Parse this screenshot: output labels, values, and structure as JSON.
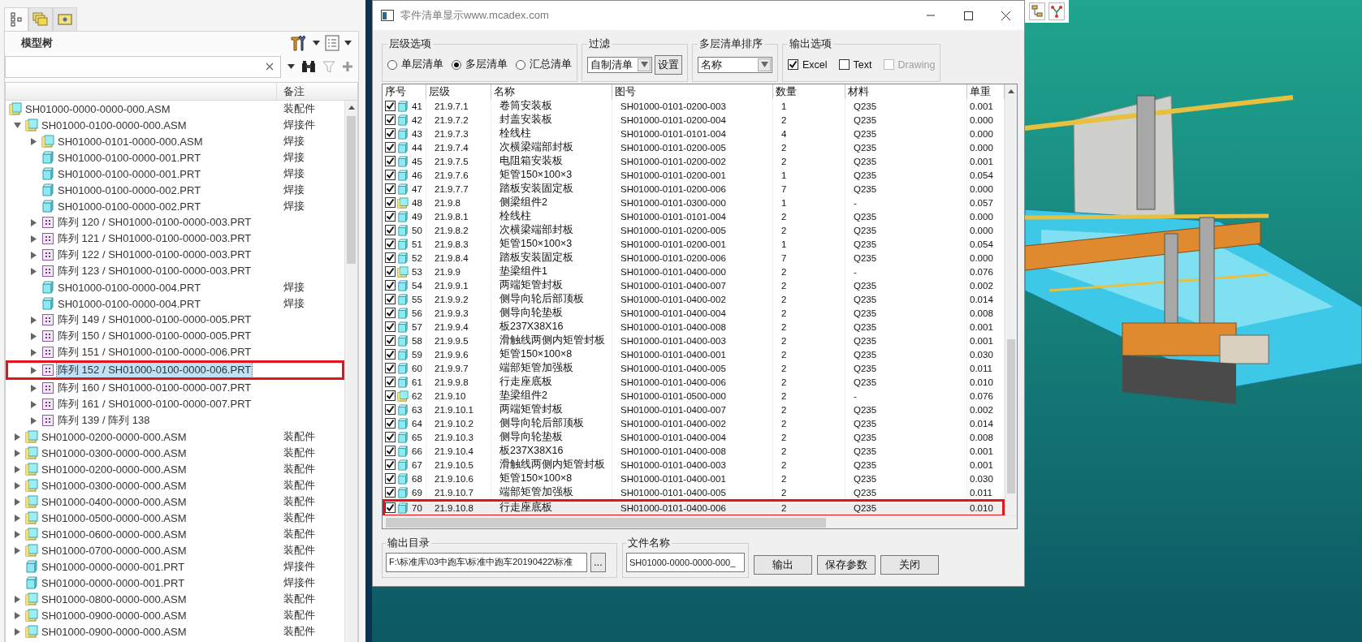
{
  "model_tree_panel": {
    "tabs": [
      {
        "kind": "tree",
        "selected": true
      },
      {
        "kind": "layers",
        "selected": false
      },
      {
        "kind": "folder",
        "selected": false
      }
    ],
    "title": "模型树",
    "column_header": "备注",
    "items": [
      {
        "kind": "asm",
        "label": "SH01000-0000-0000-000.ASM",
        "note": "装配件",
        "selected": false,
        "marked": false,
        "children": [
          {
            "kind": "asm",
            "label": "SH01000-0100-0000-000.ASM",
            "note": "焊接件",
            "expanded": true,
            "selected": false,
            "marked": false,
            "children": [
              {
                "kind": "asm",
                "label": "SH01000-0101-0000-000.ASM",
                "note": "焊接",
                "expanded": false,
                "selected": false,
                "marked": false
              },
              {
                "kind": "prt",
                "label": "SH01000-0100-0000-001.PRT",
                "note": "焊接",
                "selected": false,
                "marked": false
              },
              {
                "kind": "prt",
                "label": "SH01000-0100-0000-001.PRT",
                "note": "焊接",
                "selected": false,
                "marked": false
              },
              {
                "kind": "prt",
                "label": "SH01000-0100-0000-002.PRT",
                "note": "焊接",
                "selected": false,
                "marked": false
              },
              {
                "kind": "prt",
                "label": "SH01000-0100-0000-002.PRT",
                "note": "焊接",
                "selected": false,
                "marked": false
              },
              {
                "kind": "pattern",
                "label": "阵列 120 / SH01000-0100-0000-003.PRT",
                "expanded": false,
                "selected": false,
                "marked": false
              },
              {
                "kind": "pattern",
                "label": "阵列 121 / SH01000-0100-0000-003.PRT",
                "expanded": false,
                "selected": false,
                "marked": false
              },
              {
                "kind": "pattern",
                "label": "阵列 122 / SH01000-0100-0000-003.PRT",
                "expanded": false,
                "selected": false,
                "marked": false
              },
              {
                "kind": "pattern",
                "label": "阵列 123 / SH01000-0100-0000-003.PRT",
                "expanded": false,
                "selected": false,
                "marked": false
              },
              {
                "kind": "prt",
                "label": "SH01000-0100-0000-004.PRT",
                "note": "焊接",
                "selected": false,
                "marked": false
              },
              {
                "kind": "prt",
                "label": "SH01000-0100-0000-004.PRT",
                "note": "焊接",
                "selected": false,
                "marked": false
              },
              {
                "kind": "pattern",
                "label": "阵列 149 / SH01000-0100-0000-005.PRT",
                "expanded": false,
                "selected": false,
                "marked": false
              },
              {
                "kind": "pattern",
                "label": "阵列 150 / SH01000-0100-0000-005.PRT",
                "expanded": false,
                "selected": false,
                "marked": false
              },
              {
                "kind": "pattern",
                "label": "阵列 151 / SH01000-0100-0000-006.PRT",
                "expanded": false,
                "selected": false,
                "marked": false
              },
              {
                "kind": "pattern",
                "label": "阵列 152 / SH01000-0100-0000-006.PRT",
                "expanded": false,
                "selected": true,
                "marked": true
              },
              {
                "kind": "pattern",
                "label": "阵列 160 / SH01000-0100-0000-007.PRT",
                "expanded": false,
                "selected": false,
                "marked": false
              },
              {
                "kind": "pattern",
                "label": "阵列 161 / SH01000-0100-0000-007.PRT",
                "expanded": false,
                "selected": false,
                "marked": false
              },
              {
                "kind": "pattern",
                "label": "阵列 139 / 阵列 138",
                "expanded": false,
                "selected": false,
                "marked": false
              }
            ]
          },
          {
            "kind": "asm",
            "label": "SH01000-0200-0000-000.ASM",
            "note": "装配件",
            "expanded": false,
            "selected": false,
            "marked": false
          },
          {
            "kind": "asm",
            "label": "SH01000-0300-0000-000.ASM",
            "note": "装配件",
            "expanded": false,
            "selected": false,
            "marked": false
          },
          {
            "kind": "asm",
            "label": "SH01000-0200-0000-000.ASM",
            "note": "装配件",
            "expanded": false,
            "selected": false,
            "marked": false
          },
          {
            "kind": "asm",
            "label": "SH01000-0300-0000-000.ASM",
            "note": "装配件",
            "expanded": false,
            "selected": false,
            "marked": false
          },
          {
            "kind": "asm",
            "label": "SH01000-0400-0000-000.ASM",
            "note": "装配件",
            "expanded": false,
            "selected": false,
            "marked": false
          },
          {
            "kind": "asm",
            "label": "SH01000-0500-0000-000.ASM",
            "note": "装配件",
            "expanded": false,
            "selected": false,
            "marked": false
          },
          {
            "kind": "asm",
            "label": "SH01000-0600-0000-000.ASM",
            "note": "装配件",
            "expanded": false,
            "selected": false,
            "marked": false
          },
          {
            "kind": "asm",
            "label": "SH01000-0700-0000-000.ASM",
            "note": "装配件",
            "expanded": false,
            "selected": false,
            "marked": false
          },
          {
            "kind": "prt",
            "label": "SH01000-0000-0000-001.PRT",
            "note": "焊接件",
            "selected": false,
            "marked": false
          },
          {
            "kind": "prt",
            "label": "SH01000-0000-0000-001.PRT",
            "note": "焊接件",
            "selected": false,
            "marked": false
          },
          {
            "kind": "asm",
            "label": "SH01000-0800-0000-000.ASM",
            "note": "装配件",
            "expanded": false,
            "selected": false,
            "marked": false
          },
          {
            "kind": "asm",
            "label": "SH01000-0900-0000-000.ASM",
            "note": "装配件",
            "expanded": false,
            "selected": false,
            "marked": false
          },
          {
            "kind": "asm",
            "label": "SH01000-0900-0000-000.ASM",
            "note": "装配件",
            "expanded": false,
            "selected": false,
            "marked": false
          }
        ]
      }
    ]
  },
  "bom_dialog": {
    "title": "零件清单显示www.mcadex.com",
    "level_options": {
      "label": "层级选项",
      "options": [
        {
          "label": "单层清单",
          "selected": false
        },
        {
          "label": "多层清单",
          "selected": true
        },
        {
          "label": "汇总清单",
          "selected": false
        }
      ]
    },
    "filter": {
      "label": "过滤",
      "value": "自制清单",
      "button": "设置"
    },
    "sort": {
      "label": "多层清单排序",
      "value": "名称"
    },
    "output_options": {
      "label": "输出选项",
      "options": [
        {
          "label": "Excel",
          "checked": true,
          "disabled": false
        },
        {
          "label": "Text",
          "checked": false,
          "disabled": false
        },
        {
          "label": "Drawing",
          "checked": false,
          "disabled": true
        }
      ]
    },
    "table": {
      "columns": [
        "序号",
        "层级",
        "名称",
        "图号",
        "数量",
        "材料",
        "单重"
      ],
      "rows": [
        {
          "kind": "prt",
          "checked": true,
          "number": "41",
          "level": "21.9.7.1",
          "name": "卷筒安装板",
          "drawing_no": "SH01000-0101-0200-003",
          "quantity": "1",
          "material": "Q235",
          "unit_weight": "0.001",
          "selected": false,
          "marked": false
        },
        {
          "kind": "prt",
          "checked": true,
          "number": "42",
          "level": "21.9.7.2",
          "name": "封盖安装板",
          "drawing_no": "SH01000-0101-0200-004",
          "quantity": "2",
          "material": "Q235",
          "unit_weight": "0.000",
          "selected": false,
          "marked": false
        },
        {
          "kind": "prt",
          "checked": true,
          "number": "43",
          "level": "21.9.7.3",
          "name": "栓线柱",
          "drawing_no": "SH01000-0101-0101-004",
          "quantity": "4",
          "material": "Q235",
          "unit_weight": "0.000",
          "selected": false,
          "marked": false
        },
        {
          "kind": "prt",
          "checked": true,
          "number": "44",
          "level": "21.9.7.4",
          "name": "次横梁端部封板",
          "drawing_no": "SH01000-0101-0200-005",
          "quantity": "2",
          "material": "Q235",
          "unit_weight": "0.000",
          "selected": false,
          "marked": false
        },
        {
          "kind": "prt",
          "checked": true,
          "number": "45",
          "level": "21.9.7.5",
          "name": "电阻箱安装板",
          "drawing_no": "SH01000-0101-0200-002",
          "quantity": "2",
          "material": "Q235",
          "unit_weight": "0.001",
          "selected": false,
          "marked": false
        },
        {
          "kind": "prt",
          "checked": true,
          "number": "46",
          "level": "21.9.7.6",
          "name": "矩管150×100×3",
          "drawing_no": "SH01000-0101-0200-001",
          "quantity": "1",
          "material": "Q235",
          "unit_weight": "0.054",
          "selected": false,
          "marked": false
        },
        {
          "kind": "prt",
          "checked": true,
          "number": "47",
          "level": "21.9.7.7",
          "name": "踏板安装固定板",
          "drawing_no": "SH01000-0101-0200-006",
          "quantity": "7",
          "material": "Q235",
          "unit_weight": "0.000",
          "selected": false,
          "marked": false
        },
        {
          "kind": "asm",
          "checked": true,
          "number": "48",
          "level": "21.9.8",
          "name": "侧梁组件2",
          "drawing_no": "SH01000-0101-0300-000",
          "quantity": "1",
          "material": "-",
          "unit_weight": "0.057",
          "selected": false,
          "marked": false
        },
        {
          "kind": "prt",
          "checked": true,
          "number": "49",
          "level": "21.9.8.1",
          "name": "栓线柱",
          "drawing_no": "SH01000-0101-0101-004",
          "quantity": "2",
          "material": "Q235",
          "unit_weight": "0.000",
          "selected": false,
          "marked": false
        },
        {
          "kind": "prt",
          "checked": true,
          "number": "50",
          "level": "21.9.8.2",
          "name": "次横梁端部封板",
          "drawing_no": "SH01000-0101-0200-005",
          "quantity": "2",
          "material": "Q235",
          "unit_weight": "0.000",
          "selected": false,
          "marked": false
        },
        {
          "kind": "prt",
          "checked": true,
          "number": "51",
          "level": "21.9.8.3",
          "name": "矩管150×100×3",
          "drawing_no": "SH01000-0101-0200-001",
          "quantity": "1",
          "material": "Q235",
          "unit_weight": "0.054",
          "selected": false,
          "marked": false
        },
        {
          "kind": "prt",
          "checked": true,
          "number": "52",
          "level": "21.9.8.4",
          "name": "踏板安装固定板",
          "drawing_no": "SH01000-0101-0200-006",
          "quantity": "7",
          "material": "Q235",
          "unit_weight": "0.000",
          "selected": false,
          "marked": false
        },
        {
          "kind": "asm",
          "checked": true,
          "number": "53",
          "level": "21.9.9",
          "name": "垫梁组件1",
          "drawing_no": "SH01000-0101-0400-000",
          "quantity": "2",
          "material": "-",
          "unit_weight": "0.076",
          "selected": false,
          "marked": false
        },
        {
          "kind": "prt",
          "checked": true,
          "number": "54",
          "level": "21.9.9.1",
          "name": "两端矩管封板",
          "drawing_no": "SH01000-0101-0400-007",
          "quantity": "2",
          "material": "Q235",
          "unit_weight": "0.002",
          "selected": false,
          "marked": false
        },
        {
          "kind": "prt",
          "checked": true,
          "number": "55",
          "level": "21.9.9.2",
          "name": "侧导向轮后部顶板",
          "drawing_no": "SH01000-0101-0400-002",
          "quantity": "2",
          "material": "Q235",
          "unit_weight": "0.014",
          "selected": false,
          "marked": false
        },
        {
          "kind": "prt",
          "checked": true,
          "number": "56",
          "level": "21.9.9.3",
          "name": "侧导向轮垫板",
          "drawing_no": "SH01000-0101-0400-004",
          "quantity": "2",
          "material": "Q235",
          "unit_weight": "0.008",
          "selected": false,
          "marked": false
        },
        {
          "kind": "prt",
          "checked": true,
          "number": "57",
          "level": "21.9.9.4",
          "name": "板237X38X16",
          "drawing_no": "SH01000-0101-0400-008",
          "quantity": "2",
          "material": "Q235",
          "unit_weight": "0.001",
          "selected": false,
          "marked": false
        },
        {
          "kind": "prt",
          "checked": true,
          "number": "58",
          "level": "21.9.9.5",
          "name": "滑触线两侧内矩管封板",
          "drawing_no": "SH01000-0101-0400-003",
          "quantity": "2",
          "material": "Q235",
          "unit_weight": "0.001",
          "selected": false,
          "marked": false
        },
        {
          "kind": "prt",
          "checked": true,
          "number": "59",
          "level": "21.9.9.6",
          "name": "矩管150×100×8",
          "drawing_no": "SH01000-0101-0400-001",
          "quantity": "2",
          "material": "Q235",
          "unit_weight": "0.030",
          "selected": false,
          "marked": false
        },
        {
          "kind": "prt",
          "checked": true,
          "number": "60",
          "level": "21.9.9.7",
          "name": "端部矩管加强板",
          "drawing_no": "SH01000-0101-0400-005",
          "quantity": "2",
          "material": "Q235",
          "unit_weight": "0.011",
          "selected": false,
          "marked": false
        },
        {
          "kind": "prt",
          "checked": true,
          "number": "61",
          "level": "21.9.9.8",
          "name": "行走座底板",
          "drawing_no": "SH01000-0101-0400-006",
          "quantity": "2",
          "material": "Q235",
          "unit_weight": "0.010",
          "selected": false,
          "marked": false
        },
        {
          "kind": "asm",
          "checked": true,
          "number": "62",
          "level": "21.9.10",
          "name": "垫梁组件2",
          "drawing_no": "SH01000-0101-0500-000",
          "quantity": "2",
          "material": "-",
          "unit_weight": "0.076",
          "selected": false,
          "marked": false
        },
        {
          "kind": "prt",
          "checked": true,
          "number": "63",
          "level": "21.9.10.1",
          "name": "两端矩管封板",
          "drawing_no": "SH01000-0101-0400-007",
          "quantity": "2",
          "material": "Q235",
          "unit_weight": "0.002",
          "selected": false,
          "marked": false
        },
        {
          "kind": "prt",
          "checked": true,
          "number": "64",
          "level": "21.9.10.2",
          "name": "侧导向轮后部顶板",
          "drawing_no": "SH01000-0101-0400-002",
          "quantity": "2",
          "material": "Q235",
          "unit_weight": "0.014",
          "selected": false,
          "marked": false
        },
        {
          "kind": "prt",
          "checked": true,
          "number": "65",
          "level": "21.9.10.3",
          "name": "侧导向轮垫板",
          "drawing_no": "SH01000-0101-0400-004",
          "quantity": "2",
          "material": "Q235",
          "unit_weight": "0.008",
          "selected": false,
          "marked": false
        },
        {
          "kind": "prt",
          "checked": true,
          "number": "66",
          "level": "21.9.10.4",
          "name": "板237X38X16",
          "drawing_no": "SH01000-0101-0400-008",
          "quantity": "2",
          "material": "Q235",
          "unit_weight": "0.001",
          "selected": false,
          "marked": false
        },
        {
          "kind": "prt",
          "checked": true,
          "number": "67",
          "level": "21.9.10.5",
          "name": "滑触线两侧内矩管封板",
          "drawing_no": "SH01000-0101-0400-003",
          "quantity": "2",
          "material": "Q235",
          "unit_weight": "0.001",
          "selected": false,
          "marked": false
        },
        {
          "kind": "prt",
          "checked": true,
          "number": "68",
          "level": "21.9.10.6",
          "name": "矩管150×100×8",
          "drawing_no": "SH01000-0101-0400-001",
          "quantity": "2",
          "material": "Q235",
          "unit_weight": "0.030",
          "selected": false,
          "marked": false
        },
        {
          "kind": "prt",
          "checked": true,
          "number": "69",
          "level": "21.9.10.7",
          "name": "端部矩管加强板",
          "drawing_no": "SH01000-0101-0400-005",
          "quantity": "2",
          "material": "Q235",
          "unit_weight": "0.011",
          "selected": false,
          "marked": false
        },
        {
          "kind": "prt",
          "checked": true,
          "number": "70",
          "level": "21.9.10.8",
          "name": "行走座底板",
          "drawing_no": "SH01000-0101-0400-006",
          "quantity": "2",
          "material": "Q235",
          "unit_weight": "0.010",
          "selected": true,
          "marked": true
        }
      ]
    },
    "output_dir": {
      "label": "输出目录",
      "value": "F:\\标准库\\03中跑车\\标准中跑车20190422\\标准",
      "browse": "..."
    },
    "file_name": {
      "label": "文件名称",
      "value": "SH01000-0000-0000-000_"
    },
    "buttons": [
      "输出",
      "保存参数",
      "关闭"
    ]
  }
}
